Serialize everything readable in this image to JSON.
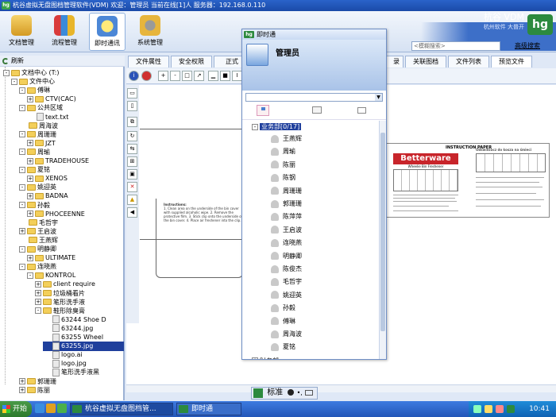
{
  "window": {
    "title": "杭谷虚拟无盘图档管理软件(VDM)  欢迎：管理员 当前在线[1]人  服务器：192.168.0.110",
    "logo": "hg"
  },
  "toolbar": {
    "buttons": [
      {
        "label": "文档管理",
        "icon": "document-manage-icon"
      },
      {
        "label": "流程管理",
        "icon": "workflow-icon"
      },
      {
        "label": "即时通讯",
        "icon": "chat-icon"
      },
      {
        "label": "系统管理",
        "icon": "system-settings-icon"
      }
    ],
    "brand_name": "杭谷 VDM",
    "brand_sub": "杭州软件 大普开",
    "brand_box": "hg",
    "search_placeholder": "<模糊搜索>",
    "advanced_search": "高级搜索"
  },
  "left_panel": {
    "refresh_label": "刷新",
    "tree": [
      {
        "label": "文档中心 (T:)",
        "level": 0,
        "type": "drive",
        "exp": "-"
      },
      {
        "label": "文件中心",
        "level": 1,
        "type": "folder",
        "exp": "-"
      },
      {
        "label": "傅琳",
        "level": 2,
        "type": "folder",
        "exp": "-"
      },
      {
        "label": "CTV(CAC)",
        "level": 3,
        "type": "folder",
        "exp": "+"
      },
      {
        "label": "公共区域",
        "level": 2,
        "type": "folder",
        "exp": "-"
      },
      {
        "label": "text.txt",
        "level": 3,
        "type": "file",
        "exp": ""
      },
      {
        "label": "周海波",
        "level": 2,
        "type": "folder",
        "exp": ""
      },
      {
        "label": "周珊珊",
        "level": 2,
        "type": "folder",
        "exp": "-"
      },
      {
        "label": "JZT",
        "level": 3,
        "type": "folder",
        "exp": "+"
      },
      {
        "label": "周瑜",
        "level": 2,
        "type": "folder",
        "exp": "-"
      },
      {
        "label": "TRADEHOUSE",
        "level": 3,
        "type": "folder",
        "exp": "+"
      },
      {
        "label": "夏铭",
        "level": 2,
        "type": "folder",
        "exp": "-"
      },
      {
        "label": "XENOS",
        "level": 3,
        "type": "folder",
        "exp": "+"
      },
      {
        "label": "姚迎英",
        "level": 2,
        "type": "folder",
        "exp": "-"
      },
      {
        "label": "BADNA",
        "level": 3,
        "type": "folder",
        "exp": "+"
      },
      {
        "label": "孙毅",
        "level": 2,
        "type": "folder",
        "exp": "-"
      },
      {
        "label": "PHOCEENNE",
        "level": 3,
        "type": "folder",
        "exp": "+"
      },
      {
        "label": "毛哲宇",
        "level": 2,
        "type": "folder",
        "exp": ""
      },
      {
        "label": "王启波",
        "level": 2,
        "type": "folder",
        "exp": "+"
      },
      {
        "label": "王燕辉",
        "level": 2,
        "type": "folder",
        "exp": ""
      },
      {
        "label": "明静卿",
        "level": 2,
        "type": "folder",
        "exp": "-"
      },
      {
        "label": "ULTIMATE",
        "level": 3,
        "type": "folder",
        "exp": "+"
      },
      {
        "label": "连晓燕",
        "level": 2,
        "type": "folder",
        "exp": "-"
      },
      {
        "label": "KONTROL",
        "level": 3,
        "type": "folder",
        "exp": "-"
      },
      {
        "label": "client require",
        "level": 4,
        "type": "folder",
        "exp": "+"
      },
      {
        "label": "垃圾桶看片",
        "level": 4,
        "type": "folder",
        "exp": "+"
      },
      {
        "label": "笔形洗手液",
        "level": 4,
        "type": "folder",
        "exp": "+"
      },
      {
        "label": "鞋形除臭膏",
        "level": 4,
        "type": "folder",
        "exp": "-"
      },
      {
        "label": "63244 Shoe D",
        "level": 5,
        "type": "file",
        "exp": ""
      },
      {
        "label": "63244.jpg",
        "level": 5,
        "type": "file",
        "exp": ""
      },
      {
        "label": "63255 Wheel",
        "level": 5,
        "type": "file",
        "exp": ""
      },
      {
        "label": "63255.jpg",
        "level": 5,
        "type": "file",
        "exp": "",
        "selected": true
      },
      {
        "label": "logo.ai",
        "level": 5,
        "type": "file",
        "exp": ""
      },
      {
        "label": "logo.jpg",
        "level": 5,
        "type": "file",
        "exp": ""
      },
      {
        "label": "笔形洗手液黑",
        "level": 5,
        "type": "file",
        "exp": ""
      },
      {
        "label": "郭珊珊",
        "level": 2,
        "type": "folder",
        "exp": "+"
      },
      {
        "label": "陈丽",
        "level": 2,
        "type": "folder",
        "exp": "+"
      }
    ]
  },
  "tabs": [
    "文件属性",
    "安全权限",
    "正式",
    "录",
    "关联图档",
    "文件列表",
    "预览文件"
  ],
  "preview": {
    "paper_title": "INSTRUCTION PAPER",
    "brand": "Betterware",
    "brand_sub": "Wheelie Bin Freshener",
    "right_heading": "Odświeżacz do kosza na śmieci",
    "instructions_heading": "Instructions:",
    "instructions_text": "1. Clean area on the underside of the bin cover with supplied alcoholic wipe. 2. Remove the protective film. 3. Stick clip onto the underside of the bin cover. 4. Place air freshener into the clip."
  },
  "status_bar": {
    "input_mode": "标准"
  },
  "chat": {
    "title": "即时通",
    "user": "管理员",
    "group": "业务部[0/17]",
    "members": [
      "王燕辉",
      "周瑜",
      "陈丽",
      "陈钢",
      "周珊珊",
      "郭珊珊",
      "陈萍萍",
      "王启波",
      "连晓燕",
      "明静卿",
      "陈俊杰",
      "毛哲宇",
      "姚迎英",
      "孙毅",
      "傅琳",
      "周海波",
      "夏铭"
    ],
    "next_group": "财务部"
  },
  "taskbar": {
    "start": "开始",
    "items": [
      "杭谷虚拟无盘图档管...",
      "即时通"
    ],
    "clock": "10:41"
  }
}
